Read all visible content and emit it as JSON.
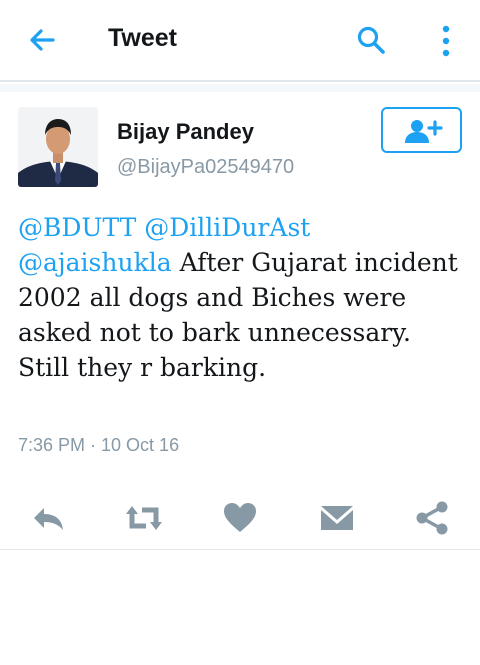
{
  "appbar": {
    "title": "Tweet",
    "back_icon": "arrow-left-icon",
    "search_icon": "search-icon",
    "more_icon": "more-vertical-icon"
  },
  "tweet": {
    "author_name": "Bijay Pandey",
    "author_handle": "@BijayPa02549470",
    "follow_icon": "add-user-icon",
    "mentions": [
      "@BDUTT",
      "@DilliDurAst",
      "@ajaishukla"
    ],
    "text": "After Gujarat incident 2002 all dogs and Biches were asked not to bark unnecessary. Still they r barking.",
    "timestamp": "7:36 PM · 10 Oct 16"
  },
  "actions": [
    "reply-icon",
    "retweet-icon",
    "like-icon",
    "direct-message-icon",
    "share-icon"
  ],
  "colors": {
    "accent": "#1da1f2",
    "icon_gray": "#8899a6",
    "divider": "#e1e8ed",
    "text": "#14171a"
  }
}
